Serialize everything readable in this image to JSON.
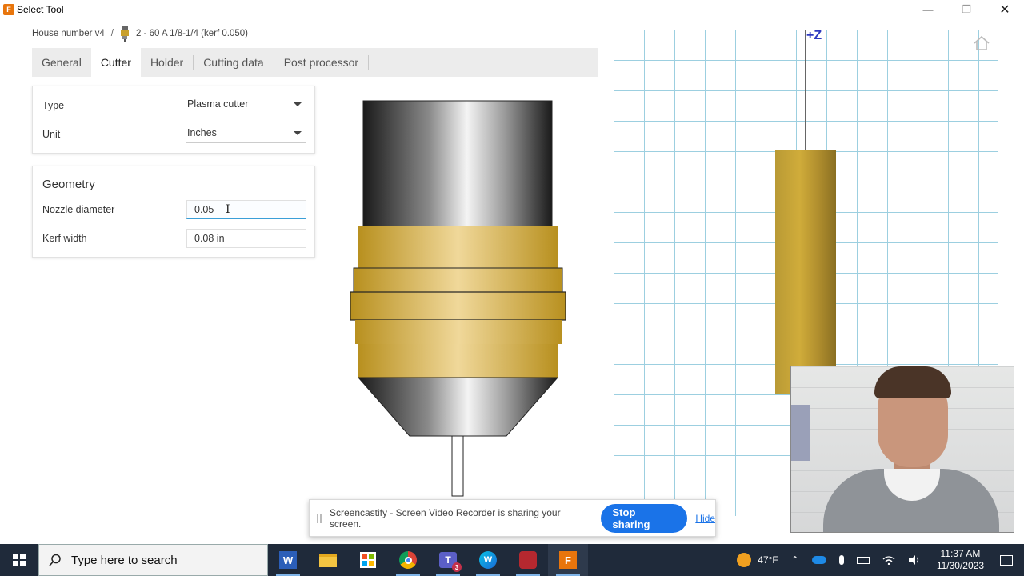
{
  "window": {
    "title": "Select Tool",
    "minimize": "—",
    "maximize": "❐",
    "close": "✕"
  },
  "breadcrumb": {
    "document": "House number v4",
    "separator": "/",
    "tool": "2 - 60 A 1/8-1/4 (kerf 0.050)"
  },
  "tabs": [
    {
      "label": "General"
    },
    {
      "label": "Cutter"
    },
    {
      "label": "Holder"
    },
    {
      "label": "Cutting data"
    },
    {
      "label": "Post processor"
    }
  ],
  "type_panel": {
    "type_label": "Type",
    "type_value": "Plasma cutter",
    "unit_label": "Unit",
    "unit_value": "Inches"
  },
  "geometry": {
    "title": "Geometry",
    "nozzle_label": "Nozzle diameter",
    "nozzle_value": "0.05",
    "kerf_label": "Kerf width",
    "kerf_value": "0.08 in"
  },
  "viewport": {
    "axis_label": "+Z"
  },
  "share_bar": {
    "message": "Screencastify - Screen Video Recorder is sharing your screen.",
    "stop_label": "Stop sharing",
    "hide_label": "Hide"
  },
  "taskbar": {
    "search_placeholder": "Type here to search",
    "weather": "47°F",
    "time": "11:37 AM",
    "date": "11/30/2023",
    "teams_badge": "3"
  },
  "colors": {
    "accent": "#1a73e8",
    "grid": "#9ccfe0",
    "gold": "#c9a02c",
    "axis_label": "#2e3ac0"
  }
}
